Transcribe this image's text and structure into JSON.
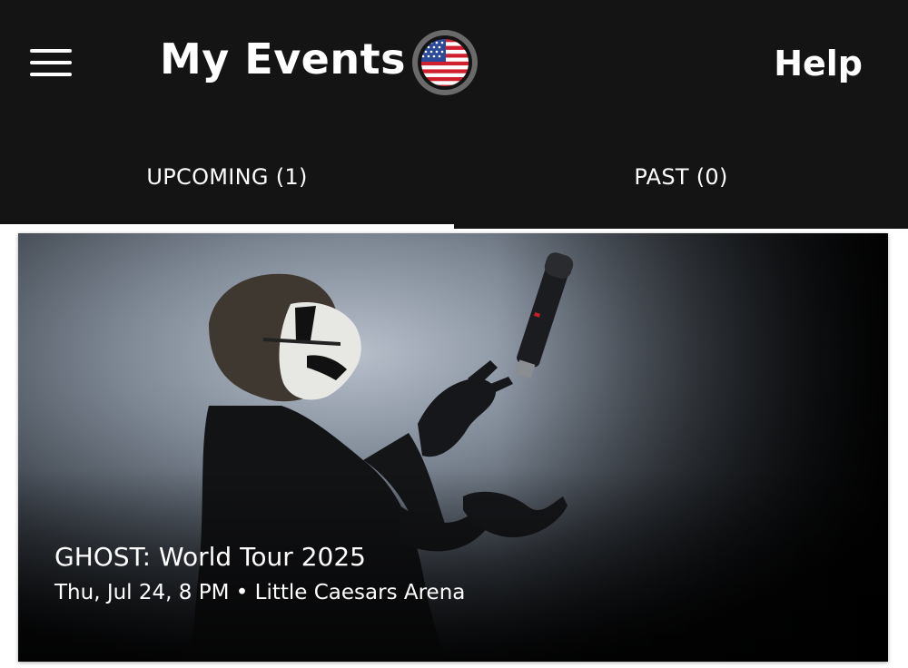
{
  "header": {
    "menu_icon": "hamburger-menu-icon",
    "title": "My Events",
    "region_icon": "us-flag-icon",
    "help_label": "Help"
  },
  "tabs": [
    {
      "label": "UPCOMING (1)",
      "active": true
    },
    {
      "label": "PAST (0)",
      "active": false
    }
  ],
  "events": [
    {
      "title": "GHOST: World Tour 2025",
      "date": "Thu, Jul 24, 8 PM",
      "separator": "•",
      "venue": "Little Caesars Arena"
    }
  ],
  "colors": {
    "header_bg": "#141414",
    "text": "#ffffff",
    "active_tab_indicator": "#ffffff"
  }
}
